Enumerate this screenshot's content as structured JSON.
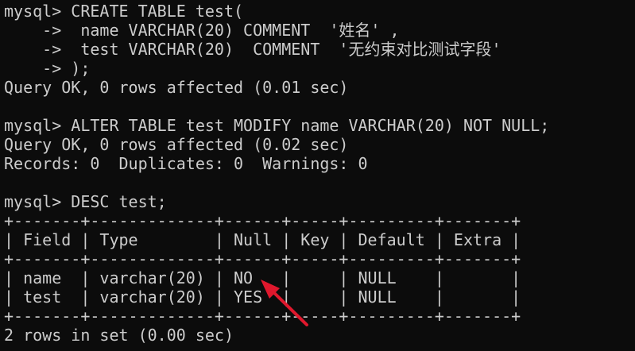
{
  "terminal": {
    "lines": [
      "mysql> CREATE TABLE test(",
      "    ->  name VARCHAR(20) COMMENT  '姓名' ,",
      "    ->  test VARCHAR(20)  COMMENT  '无约束对比测试字段'",
      "    -> );",
      "Query OK, 0 rows affected (0.01 sec)",
      "",
      "mysql> ALTER TABLE test MODIFY name VARCHAR(20) NOT NULL;",
      "Query OK, 0 rows affected (0.02 sec)",
      "Records: 0  Duplicates: 0  Warnings: 0",
      "",
      "mysql> DESC test;",
      "+-------+-------------+------+-----+---------+-------+",
      "| Field | Type        | Null | Key | Default | Extra |",
      "+-------+-------------+------+-----+---------+-------+",
      "| name  | varchar(20) | NO   |     | NULL    |       |",
      "| test  | varchar(20) | YES  |     | NULL    |       |",
      "+-------+-------------+------+-----+---------+-------+",
      "2 rows in set (0.00 sec)"
    ]
  },
  "colors": {
    "background": "#0c0c0c",
    "text": "#cccccc",
    "annotation_arrow": "#e0182d"
  },
  "icons": {
    "annotation": "red-arrow-icon"
  }
}
